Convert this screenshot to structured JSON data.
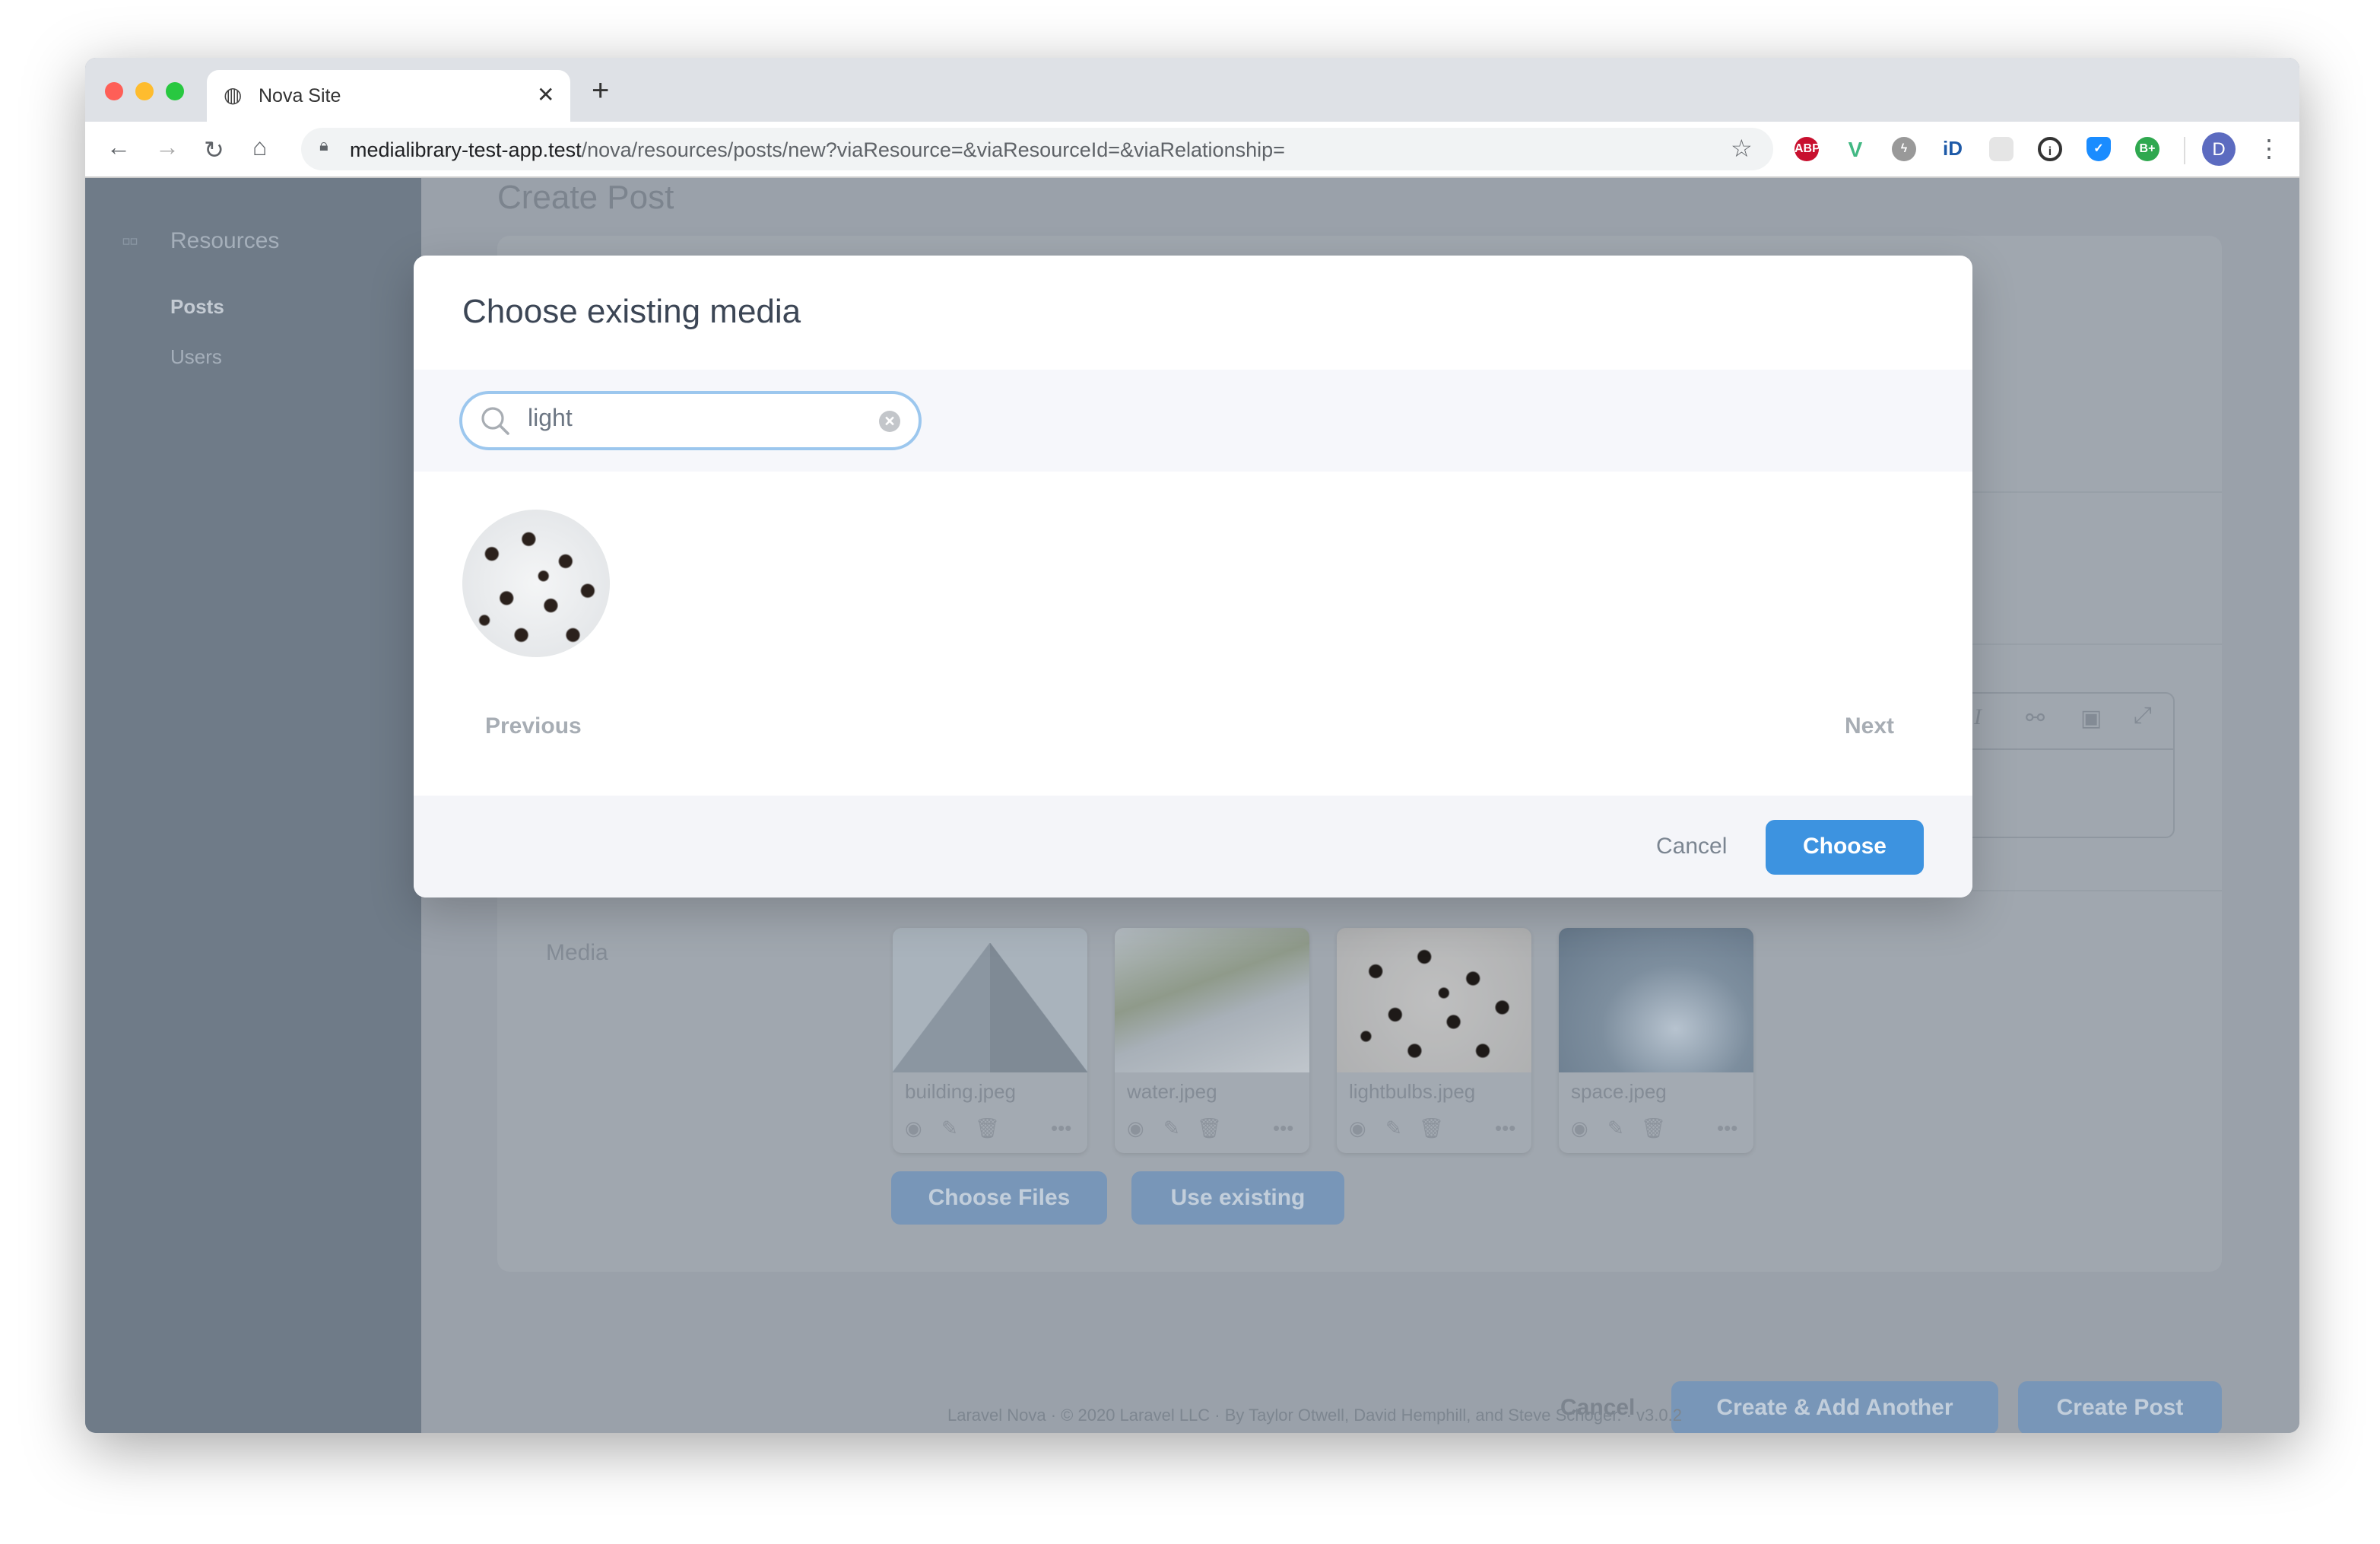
{
  "browser": {
    "tab_title": "Nova Site",
    "url_host": "medialibrary-test-app.test",
    "url_path": "/nova/resources/posts/new?viaResource=&viaResourceId=&viaRelationship=",
    "profile_initial": "D",
    "extensions": [
      "adblock-icon",
      "vue-devtools-icon",
      "lightning-icon",
      "id-icon",
      "grid-icon",
      "onepassword-icon",
      "shield-icon",
      "builtwith-icon"
    ]
  },
  "sidebar": {
    "section": "Resources",
    "items": [
      {
        "label": "Posts",
        "active": true
      },
      {
        "label": "Users",
        "active": false
      }
    ]
  },
  "page": {
    "title": "Create Post",
    "media_label": "Media",
    "media": [
      {
        "name": "building.jpeg"
      },
      {
        "name": "water.jpeg"
      },
      {
        "name": "lightbulbs.jpeg"
      },
      {
        "name": "space.jpeg"
      }
    ],
    "choose_files": "Choose Files",
    "use_existing": "Use existing",
    "cancel": "Cancel",
    "create_add_another": "Create & Add Another",
    "create": "Create Post",
    "footer": "Laravel Nova · © 2020 Laravel LLC · By Taylor Otwell, David Hemphill, and Steve Schoger. · v3.0.2"
  },
  "modal": {
    "title": "Choose existing media",
    "search_value": "light",
    "previous": "Previous",
    "next": "Next",
    "cancel": "Cancel",
    "choose": "Choose"
  },
  "colors": {
    "primary": "#3d93e0",
    "search_border": "#9cc7ee"
  }
}
